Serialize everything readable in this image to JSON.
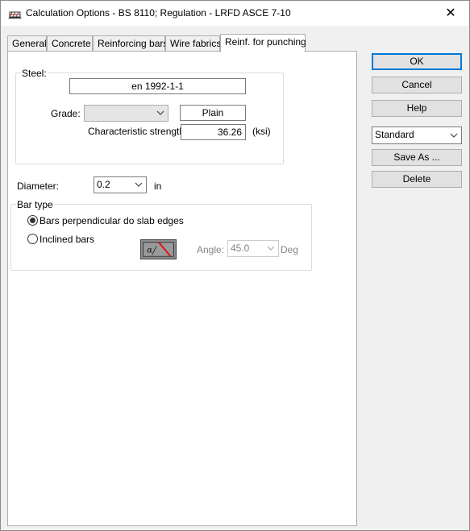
{
  "window": {
    "title": "Calculation Options - BS 8110;   Regulation - LRFD ASCE 7-10",
    "close_glyph": "✕"
  },
  "tabs": [
    {
      "label": "General"
    },
    {
      "label": "Concrete"
    },
    {
      "label": "Reinforcing bars"
    },
    {
      "label": "Wire fabrics"
    },
    {
      "label": "Reinf. for punching"
    }
  ],
  "steel": {
    "group_label": "Steel:",
    "standard": "en 1992-1-1",
    "grade_label": "Grade:",
    "grade_value": "",
    "surface": "Plain",
    "char_strength_label": "Characteristic strength",
    "char_strength_value": "36.26",
    "char_strength_unit": "(ksi)"
  },
  "diameter": {
    "label": "Diameter:",
    "value": "0.2",
    "unit": "in"
  },
  "bar_type": {
    "group_label": "Bar type",
    "option_perpendicular": "Bars perpendicular do slab edges",
    "option_inclined": "Inclined bars",
    "selected": "perpendicular",
    "angle_label": "Angle:",
    "angle_value": "45.0",
    "angle_unit": "Deg",
    "angle_symbol": "α"
  },
  "buttons": {
    "ok": "OK",
    "cancel": "Cancel",
    "help": "Help",
    "preset_value": "Standard",
    "save_as": "Save As ...",
    "delete": "Delete"
  },
  "icons": {
    "app": "calculation-app-icon",
    "close": "close-icon",
    "dropdown": "chevron-down-icon",
    "angle": "bar-angle-diagram-icon"
  },
  "colors": {
    "default_button_border": "#0078d7",
    "angle_line": "#e01010",
    "disabled_text": "#838383"
  }
}
